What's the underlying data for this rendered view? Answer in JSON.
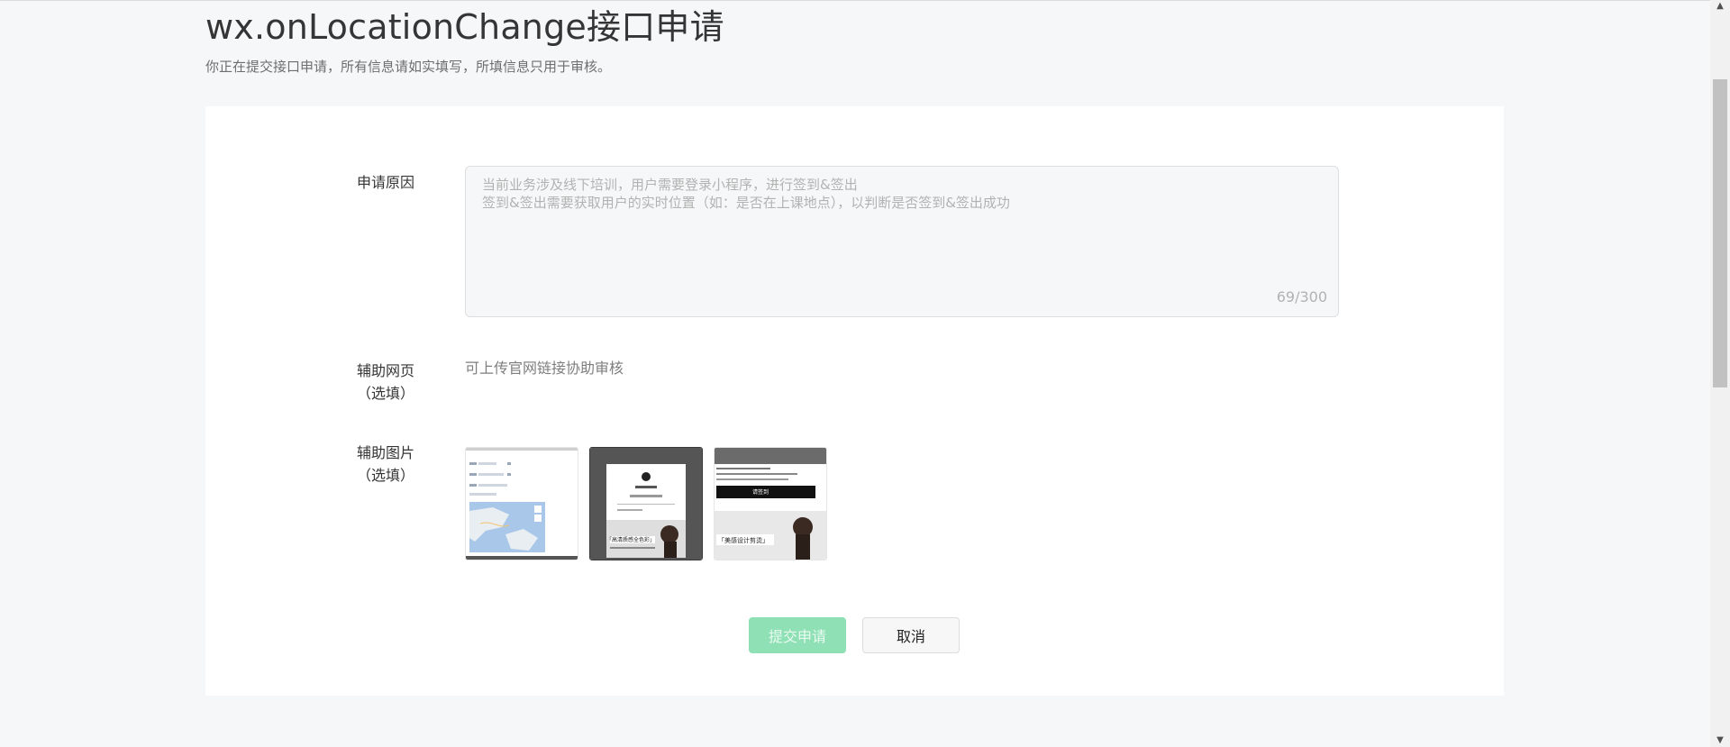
{
  "header": {
    "title": "wx.onLocationChange接口申请",
    "subtitle": "你正在提交接口申请，所有信息请如实填写，所填信息只用于审核。"
  },
  "form": {
    "reason": {
      "label": "申请原因",
      "value": "当前业务涉及线下培训，用户需要登录小程序，进行签到&签出\n签到&签出需要获取用户的实时位置（如：是否在上课地点），以判断是否签到&签出成功",
      "counter": "69/300"
    },
    "webpage": {
      "label_line1": "辅助网页",
      "label_line2": "（选填）",
      "hint": "可上传官网链接协助审核"
    },
    "images": {
      "label_line1": "辅助图片",
      "label_line2": "（选填）",
      "thumb2_text1": "「高清质感全色彩」",
      "thumb3_text1": "请签到",
      "thumb3_text2": "「美感设计剪烫」"
    }
  },
  "actions": {
    "submit_label": "提交申请",
    "cancel_label": "取消"
  },
  "colors": {
    "primary_disabled": "#8fe0b5",
    "background": "#f6f7f9"
  }
}
